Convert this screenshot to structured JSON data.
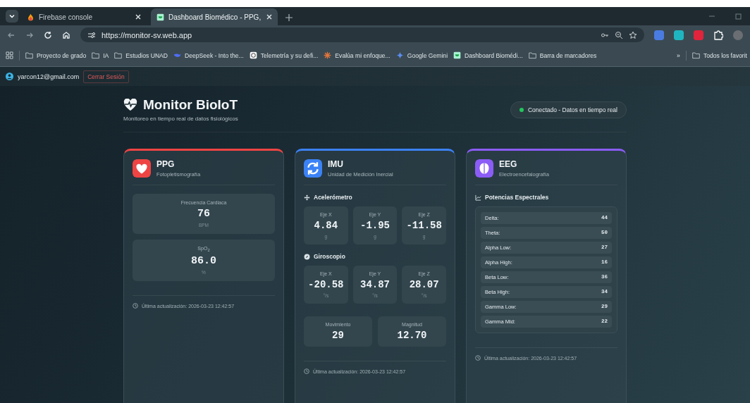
{
  "browser": {
    "tabs": [
      {
        "title": "Firebase console",
        "selected": false
      },
      {
        "title": "Dashboard Biomédico - PPG,",
        "selected": true
      }
    ],
    "address": "https://monitor-sv.web.app",
    "bookmarks": [
      {
        "label": "Proyecto de grado"
      },
      {
        "label": "IA"
      },
      {
        "label": "Estudios UNAD"
      },
      {
        "label": "DeepSeek - Into the..."
      },
      {
        "label": "Telemetría y su defi..."
      },
      {
        "label": "Evalúa mi enfoque..."
      },
      {
        "label": "Google Gemini"
      },
      {
        "label": "Dashboard Biomédi..."
      },
      {
        "label": "Barra de marcadores"
      }
    ],
    "overflow": "»",
    "all_bookmarks": "Todos los favorit"
  },
  "user": {
    "email": "yarcon12@gmail.com",
    "logout": "Cerrar Sesión"
  },
  "header": {
    "title": "Monitor BioIoT",
    "subtitle": "Monitoreo en tiempo real de datos fisiológicos",
    "status": "Conectado - Datos en tiempo real",
    "connected": true
  },
  "cards": [
    {
      "kind": "ppg",
      "title": "PPG",
      "subtitle": "Fotopletismografía",
      "color": "#ef4444",
      "metrics": [
        {
          "label": "Frecuencia Cardiaca",
          "value": "76",
          "unit": "BPM"
        },
        {
          "label": "SpO$_{2}$",
          "value": "86.0",
          "unit": "%"
        }
      ],
      "updated": "Última actualización: 2026-03-23 12:42:57"
    },
    {
      "kind": "imu",
      "title": "IMU",
      "subtitle": "Unidad de Medición Inercial",
      "color": "#3b82f6",
      "sections": [
        {
          "title": "Acelerómetro",
          "cells": [
            {
              "label": "Eje X",
              "value": "4.84",
              "unit": "g"
            },
            {
              "label": "Eje Y",
              "value": "-1.95",
              "unit": "g"
            },
            {
              "label": "Eje Z",
              "value": "-11.58",
              "unit": "g"
            }
          ]
        },
        {
          "title": "Giroscopio",
          "cells": [
            {
              "label": "Eje X",
              "value": "-20.58",
              "unit": "°/s"
            },
            {
              "label": "Eje Y",
              "value": "34.87",
              "unit": "°/s"
            },
            {
              "label": "Eje Z",
              "value": "28.07",
              "unit": "°/s"
            }
          ]
        }
      ],
      "summary": [
        {
          "label": "Movimiento",
          "value": "29"
        },
        {
          "label": "Magnitud",
          "value": "12.70"
        }
      ],
      "updated": "Última actualización: 2026-03-23 12:42:57"
    },
    {
      "kind": "eeg",
      "title": "EEG",
      "subtitle": "Electroencefalografía",
      "color": "#8b5cf6",
      "section": "Potencias Espectrales",
      "bands": [
        {
          "name": "Delta:",
          "value": "44"
        },
        {
          "name": "Theta:",
          "value": "50"
        },
        {
          "name": "Alpha Low:",
          "value": "27"
        },
        {
          "name": "Alpha High:",
          "value": "16"
        },
        {
          "name": "Beta Low:",
          "value": "36"
        },
        {
          "name": "Beta High:",
          "value": "34"
        },
        {
          "name": "Gamma Low:",
          "value": "29"
        },
        {
          "name": "Gamma Mid:",
          "value": "22"
        }
      ],
      "updated": "Última actualización: 2026-03-23 12:42:57"
    }
  ]
}
